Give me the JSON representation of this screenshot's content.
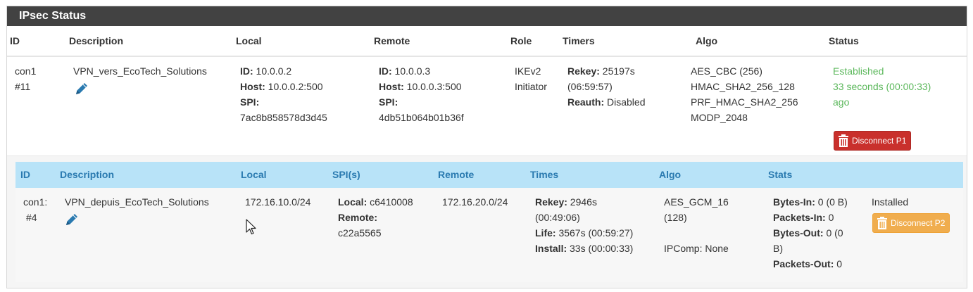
{
  "panel": {
    "title": "IPsec Status"
  },
  "p1": {
    "headers": {
      "id": "ID",
      "description": "Description",
      "local": "Local",
      "remote": "Remote",
      "role": "Role",
      "timers": "Timers",
      "algo": "Algo",
      "status": "Status"
    },
    "row": {
      "id_line1": "con1",
      "id_line2": "#11",
      "description": "VPN_vers_EcoTech_Solutions",
      "local_id_label": "ID:",
      "local_id": " 10.0.0.2",
      "local_host_label": "Host:",
      "local_host": " 10.0.0.2:500",
      "local_spi_label": "SPI:",
      "local_spi": "7ac8b858578d3d45",
      "remote_id_label": "ID:",
      "remote_id": " 10.0.0.3",
      "remote_host_label": "Host:",
      "remote_host": " 10.0.0.3:500",
      "remote_spi_label": "SPI:",
      "remote_spi": "4db51b064b01b36f",
      "role_line1": "IKEv2",
      "role_line2": "Initiator",
      "rekey_label": "Rekey:",
      "rekey": " 25197s",
      "rekey_hms": "(06:59:57)",
      "reauth_label": "Reauth:",
      "reauth": " Disabled",
      "algo_line1": "AES_CBC (256)",
      "algo_line2": "HMAC_SHA2_256_128",
      "algo_line3": "PRF_HMAC_SHA2_256",
      "algo_line4": "MODP_2048",
      "status_line1": "Established",
      "status_line2": "33 seconds (00:00:33)",
      "status_line3": "ago",
      "disconnect_label": "Disconnect P1"
    }
  },
  "p2": {
    "headers": {
      "id": "ID",
      "description": "Description",
      "local": "Local",
      "spis": "SPI(s)",
      "remote": "Remote",
      "times": "Times",
      "algo": "Algo",
      "stats": "Stats"
    },
    "row": {
      "id_line1": "con1:",
      "id_line2": "#4",
      "description": "VPN_depuis_EcoTech_Solutions",
      "local": "172.16.10.0/24",
      "spi_local_label": "Local:",
      "spi_local": " c6410008",
      "spi_remote_label": "Remote:",
      "spi_remote": "c22a5565",
      "remote": "172.16.20.0/24",
      "rekey_label": "Rekey:",
      "rekey": " 2946s",
      "rekey_hms": "(00:49:06)",
      "life_label": "Life:",
      "life": " 3567s (00:59:27)",
      "install_label": "Install:",
      "install": " 33s (00:00:33)",
      "algo_line1": "AES_GCM_16",
      "algo_line2": "(128)",
      "ipcomp": "IPComp: None",
      "bytes_in_label": "Bytes-In:",
      "bytes_in": " 0 (0 B)",
      "packets_in_label": "Packets-In:",
      "packets_in": " 0",
      "bytes_out_label": "Bytes-Out:",
      "bytes_out_line1": " 0 (0",
      "bytes_out_line2": "B)",
      "packets_out_label": "Packets-Out:",
      "packets_out": " 0",
      "state": "Installed",
      "disconnect_label": "Disconnect P2"
    }
  },
  "colors": {
    "heading_bg": "#424242",
    "p2_header_bg": "#b8e3f8",
    "p2_header_text": "#2a7ab0",
    "established": "#5cb85c",
    "danger": "#c9302c",
    "warning": "#f0ad4e",
    "edit_icon": "#2a7ab0"
  },
  "icons": {
    "edit": "pencil-icon",
    "disconnect": "trash-icon",
    "cursor": "mouse-pointer-icon"
  }
}
